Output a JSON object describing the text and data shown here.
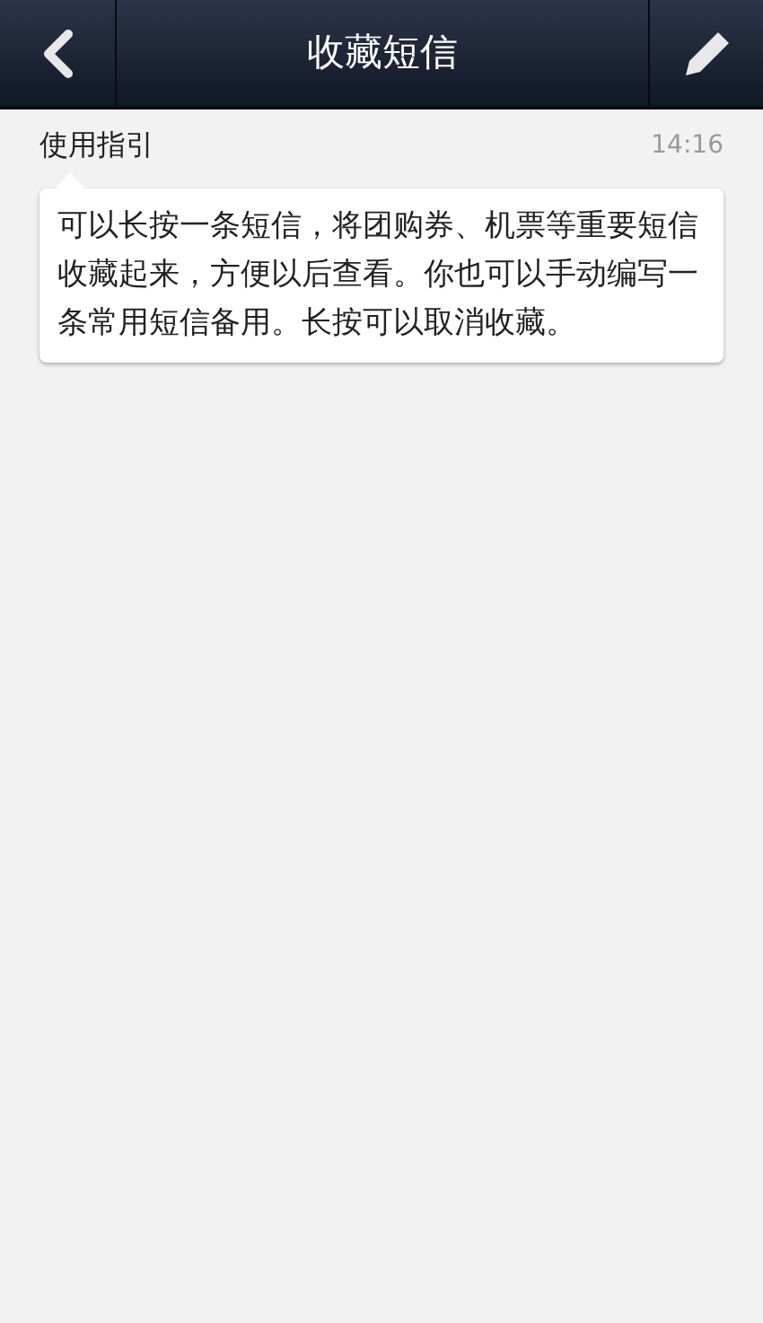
{
  "header": {
    "title": "收藏短信"
  },
  "messages": [
    {
      "sender": "使用指引",
      "time": "14:16",
      "body": "可以长按一条短信，将团购券、机票等重要短信收藏起来，方便以后查看。你也可以手动编写一条常用短信备用。长按可以取消收藏。"
    }
  ]
}
